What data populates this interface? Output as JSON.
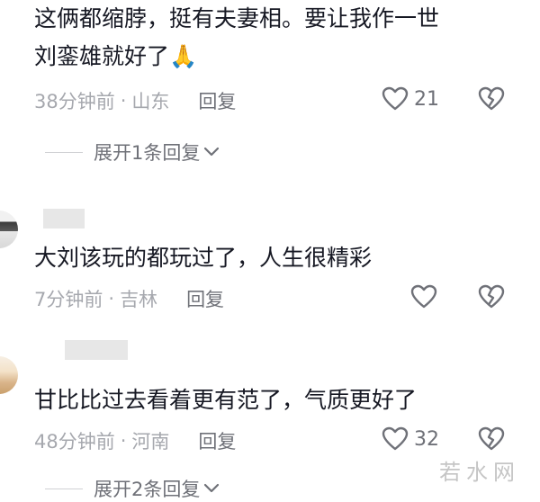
{
  "comments": [
    {
      "text": "这俩都缩脖，挺有夫妻相。要让我作一世\n刘銮雄就好了🙏",
      "time": "38分钟前",
      "dot": "·",
      "location": "山东",
      "reply_label": "回复",
      "likes": "21",
      "expand_label": "展开1条回复"
    },
    {
      "text": "大刘该玩的都玩过了，人生很精彩",
      "time": "7分钟前",
      "dot": "·",
      "location": "吉林",
      "reply_label": "回复",
      "likes": ""
    },
    {
      "text": "甘比比过去看着更有范了，气质更好了",
      "time": "48分钟前",
      "dot": "·",
      "location": "河南",
      "reply_label": "回复",
      "likes": "32",
      "expand_label": "展开2条回复"
    }
  ],
  "watermark": "若水网",
  "icons": {
    "like": "heart-outline-icon",
    "dislike": "broken-heart-icon",
    "expand": "chevron-down-icon"
  },
  "colors": {
    "text_primary": "#161823",
    "text_secondary": "#a6a8ae",
    "action": "#6f7178"
  }
}
